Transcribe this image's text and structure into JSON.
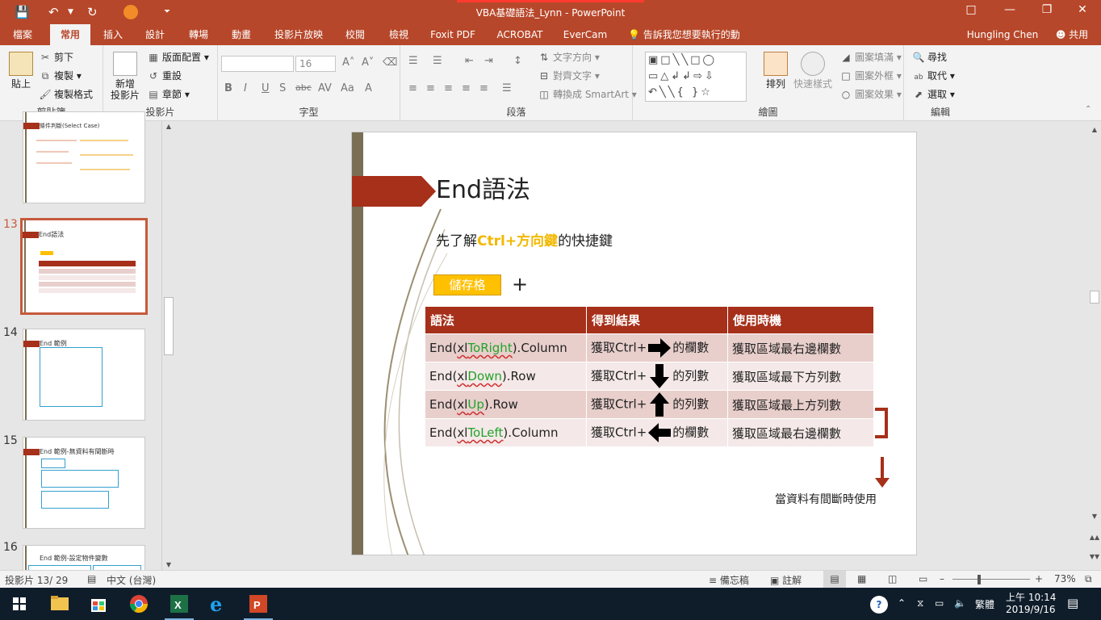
{
  "window": {
    "title": "VBA基礎語法_Lynn - PowerPoint",
    "user": "Hungling Chen",
    "share_label": "共用"
  },
  "tabs": [
    {
      "label": "檔案"
    },
    {
      "label": "常用"
    },
    {
      "label": "插入"
    },
    {
      "label": "設計"
    },
    {
      "label": "轉場"
    },
    {
      "label": "動畫"
    },
    {
      "label": "投影片放映"
    },
    {
      "label": "校閱"
    },
    {
      "label": "檢視"
    },
    {
      "label": "Foxit PDF"
    },
    {
      "label": "ACROBAT"
    },
    {
      "label": "EverCam"
    }
  ],
  "tell_me": "告訴我您想要執行的動作...",
  "ribbon": {
    "clipboard": {
      "label": "剪貼簿",
      "paste": "貼上",
      "cut": "剪下",
      "copy": "複製",
      "format_painter": "複製格式"
    },
    "slides": {
      "label": "投影片",
      "new_slide": "新增",
      "new_slide2": "投影片",
      "layout": "版面配置",
      "reset": "重設",
      "section": "章節"
    },
    "font": {
      "label": "字型",
      "size": "16"
    },
    "paragraph": {
      "label": "段落",
      "text_direction": "文字方向",
      "align_text": "對齊文字",
      "smartart": "轉換成 SmartArt"
    },
    "drawing": {
      "label": "繪圖",
      "arrange": "排列",
      "quick_styles": "快速樣式",
      "fill": "圖案填滿",
      "outline": "圖案外框",
      "effects": "圖案效果"
    },
    "editing": {
      "label": "編輯",
      "find": "尋找",
      "replace": "取代",
      "select": "選取"
    }
  },
  "thumbnails": [
    {
      "num": "",
      "title": "條件判斷(Select Case)"
    },
    {
      "num": "13",
      "title": "End語法"
    },
    {
      "num": "14",
      "title": "End 範例"
    },
    {
      "num": "15",
      "title": "End 範例-無資料有間斷時"
    },
    {
      "num": "16",
      "title": "End 範例-設定物件變數"
    }
  ],
  "slide": {
    "title": "End語法",
    "subtitle_pre": "先了解",
    "subtitle_hl": "Ctrl+方向鍵",
    "subtitle_post": "的快捷鍵",
    "save_cell": "儲存格",
    "plus": "+",
    "headers": [
      "語法",
      "得到結果",
      "使用時機"
    ],
    "rows": [
      {
        "p1": "End(",
        "xl": "xl",
        "kw": "ToRight",
        "p2": ").Column",
        "get": "獲取Ctrl+",
        "unit": "的欄數",
        "use": "獲取區域最右邊欄數",
        "dir": "right"
      },
      {
        "p1": "End(",
        "xl": "xl",
        "kw": "Down",
        "p2": ").Row",
        "get": "獲取Ctrl+",
        "unit": "的列數",
        "use": "獲取區域最下方列數",
        "dir": "down"
      },
      {
        "p1": "End(",
        "xl": "xl",
        "kw": "Up",
        "p2": ").Row",
        "get": "獲取Ctrl+",
        "unit": "的列數",
        "use": "獲取區域最上方列數",
        "dir": "up"
      },
      {
        "p1": "End(",
        "xl": "xl",
        "kw": "ToLeft",
        "p2": ").Column",
        "get": "獲取Ctrl+",
        "unit": "的欄數",
        "use": "獲取區域最右邊欄數",
        "dir": "left"
      }
    ],
    "note": "當資料有間斷時使用"
  },
  "status": {
    "slide_info": "投影片 13/ 29",
    "language": "中文 (台灣)",
    "notes": "備忘稿",
    "comments": "註解",
    "zoom": "73%"
  },
  "taskbar": {
    "ime": "繁體",
    "time": "上午 10:14",
    "date": "2019/9/16"
  },
  "colors": {
    "accent": "#b7472a",
    "banner": "#a6301a",
    "highlight": "#f2b800",
    "keyword": "#22a32a"
  }
}
